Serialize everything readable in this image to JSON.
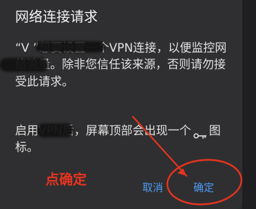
{
  "dialog": {
    "title": "网络连接请求",
    "message": "“V   ”想要设置一个VPN连接，以便监控网络流量。除非您信任该来源，否则请勿接受此请求。",
    "note_before_icon": "启用VPN后，屏幕顶部会出现一个",
    "note_after_icon": "图标。",
    "buttons": {
      "cancel_label": "取消",
      "confirm_label": "确定"
    }
  },
  "annotation": {
    "text": "点确定",
    "color": "#e8341f"
  },
  "icons": {
    "vpn": "key-icon"
  },
  "colors": {
    "dialog_background": "#2f2f31",
    "text": "#e1e1e1",
    "accent": "#4f9cf6",
    "annotation": "#e8341f"
  }
}
